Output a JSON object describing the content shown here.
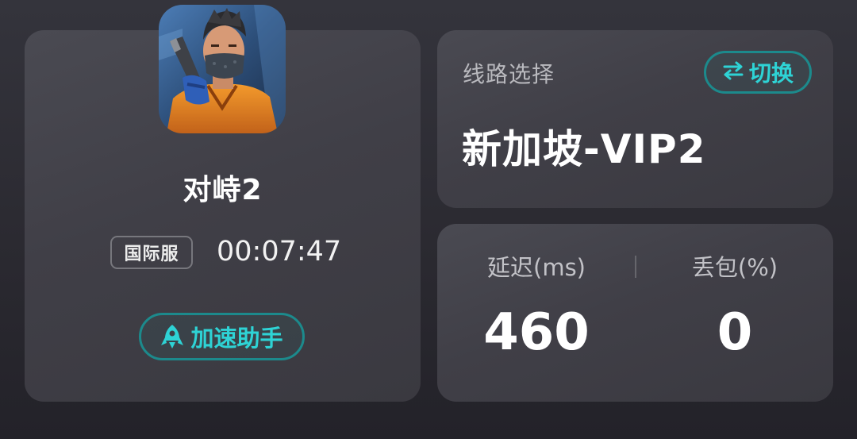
{
  "game": {
    "name": "对峙2",
    "server_badge": "国际服",
    "session_time": "00:07:47",
    "assistant_button_label": "加速助手",
    "icon_name": "game-cover-soldier-icon"
  },
  "route": {
    "label": "线路选择",
    "switch_button_label": "切换",
    "switch_icon": "swap-arrows-icon",
    "current_route": "新加坡-VIP2"
  },
  "stats": {
    "latency_label": "延迟(ms)",
    "latency_value": "460",
    "packet_loss_label": "丢包(%)",
    "packet_loss_value": "0"
  },
  "colors": {
    "accent": "#2ed3d5",
    "accent_border": "#1c8a8c",
    "card_background": "#444349",
    "page_background": "#2b2a31"
  }
}
